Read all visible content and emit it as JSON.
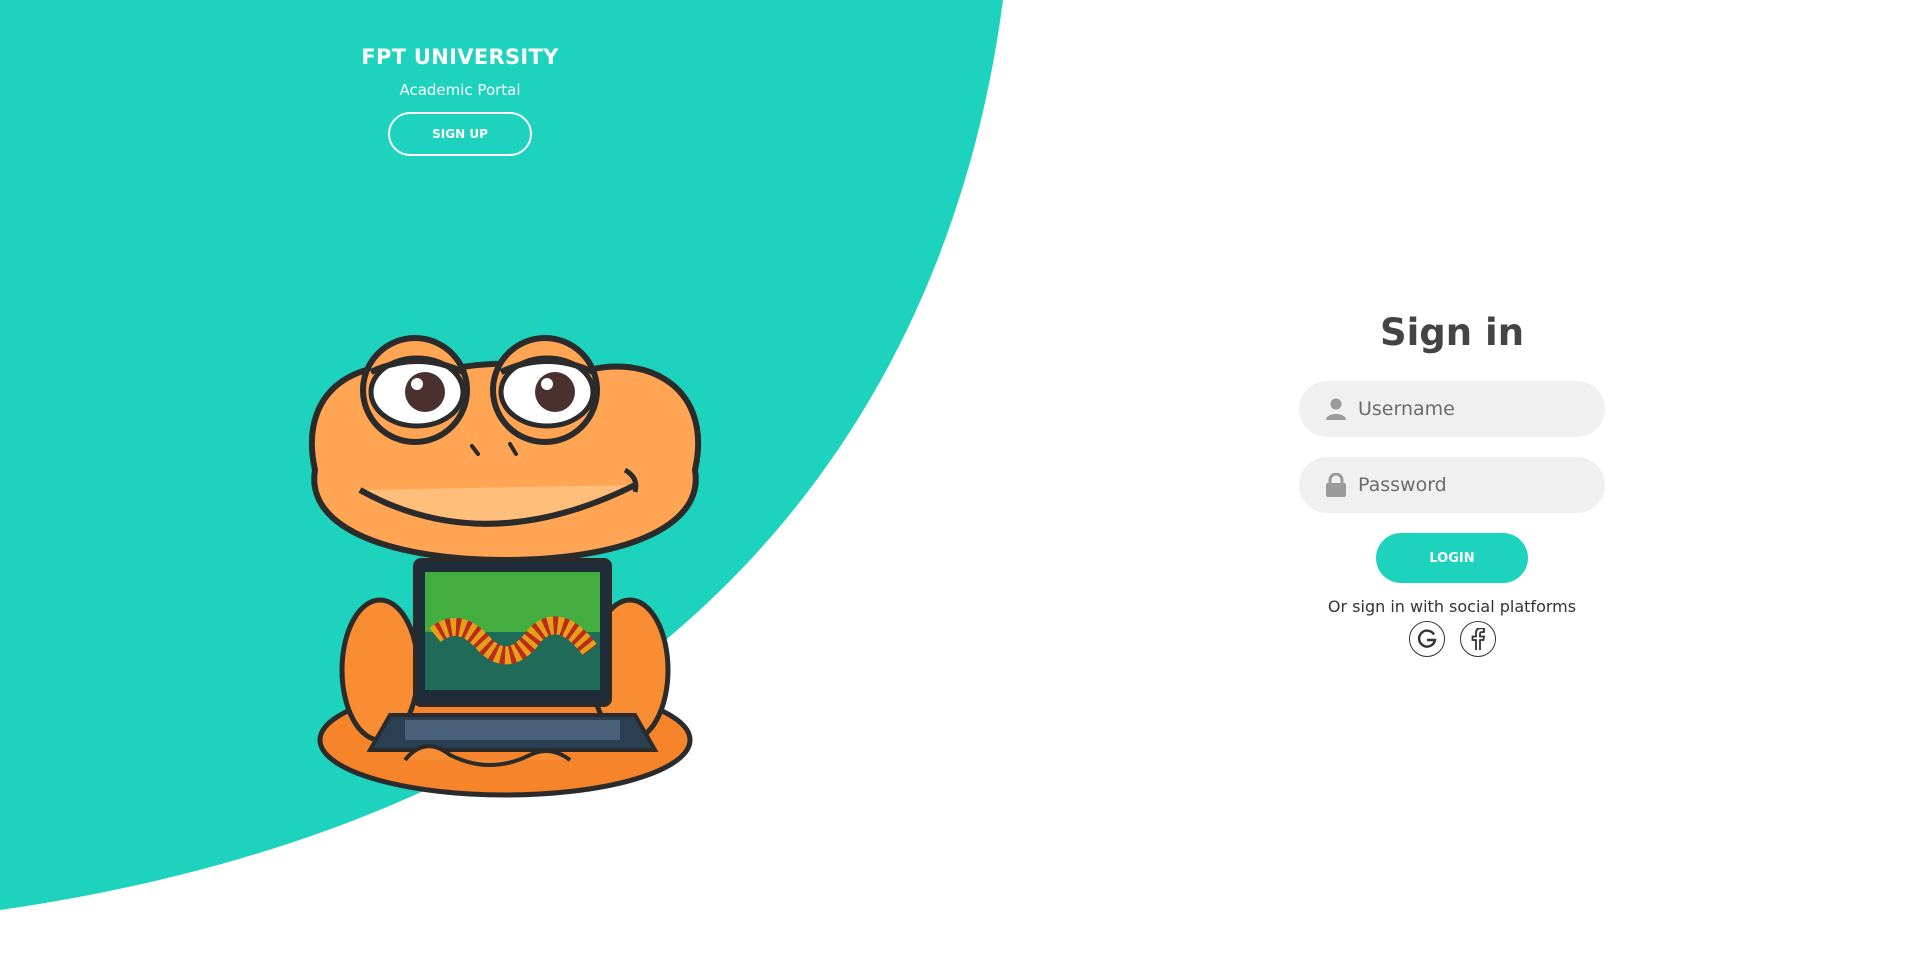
{
  "brand": {
    "title": "FPT UNIVERSITY",
    "subtitle": "Academic Portal",
    "signup_label": "SIGN UP"
  },
  "signin": {
    "title": "Sign in",
    "username_placeholder": "Username",
    "password_placeholder": "Password",
    "login_label": "LOGIN",
    "social_text": "Or sign in with social platforms",
    "social": [
      {
        "name": "google",
        "icon": "google-icon"
      },
      {
        "name": "facebook",
        "icon": "facebook-icon"
      }
    ]
  },
  "colors": {
    "accent": "#1dd3bd",
    "field_bg": "#f0f0f0",
    "title_text": "#444444"
  },
  "illustration": {
    "subject": "frog-mascot-with-laptop"
  }
}
